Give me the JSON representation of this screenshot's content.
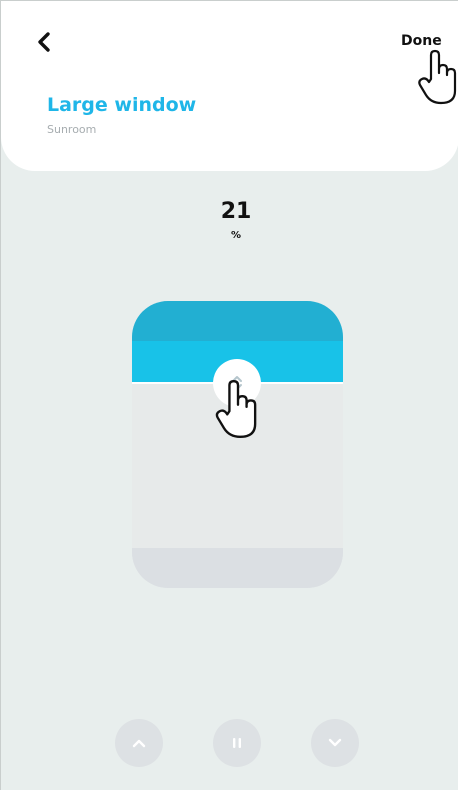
{
  "header": {
    "back_icon": "chevron-left-icon",
    "done_label": "Done",
    "title": "Large window",
    "subtitle": "Sunroom"
  },
  "position": {
    "value": "21",
    "unit": "%"
  },
  "window_control": {
    "open_percent": 21,
    "handle_icon": "drag-arrows-icon"
  },
  "controls": {
    "up_icon": "chevron-up-icon",
    "pause_icon": "pause-icon",
    "down_icon": "chevron-down-icon"
  },
  "colors": {
    "accent": "#1fb6e8",
    "shade_top": "#22afd2",
    "shade_fill": "#18c2e8",
    "background": "#e8eeed",
    "button": "#dde1e4"
  }
}
